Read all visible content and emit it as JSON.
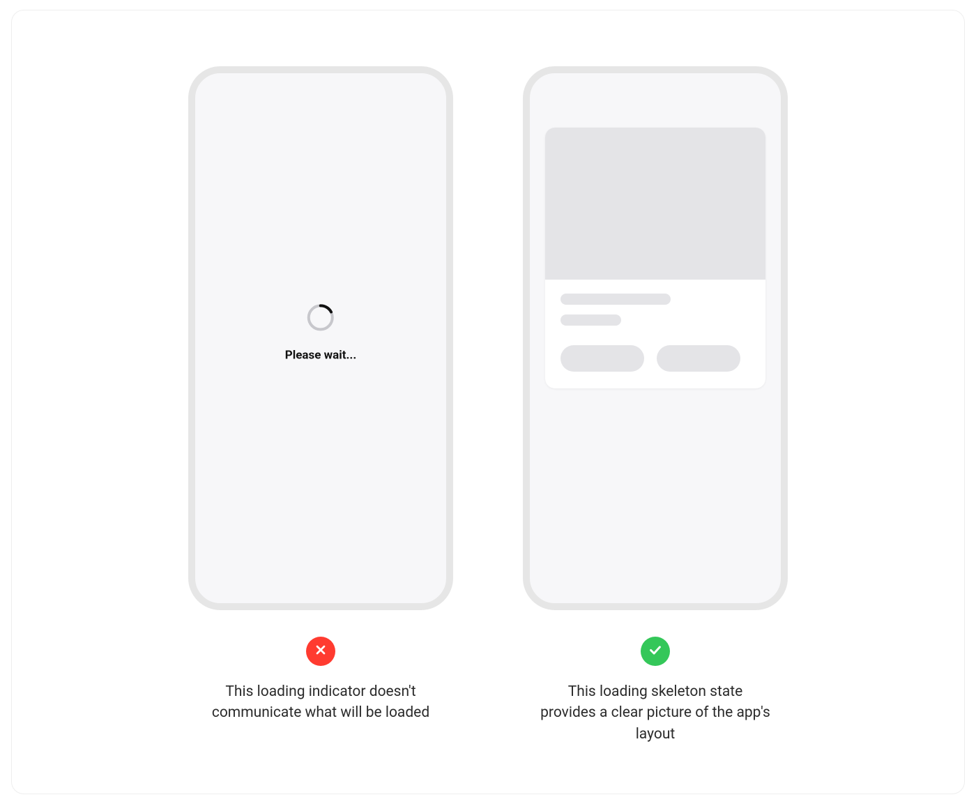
{
  "left": {
    "spinner_label": "Please wait...",
    "caption": "This loading indicator doesn't communicate what will be loaded"
  },
  "right": {
    "caption": "This loading skeleton state provides a clear picture of the app's layout"
  }
}
